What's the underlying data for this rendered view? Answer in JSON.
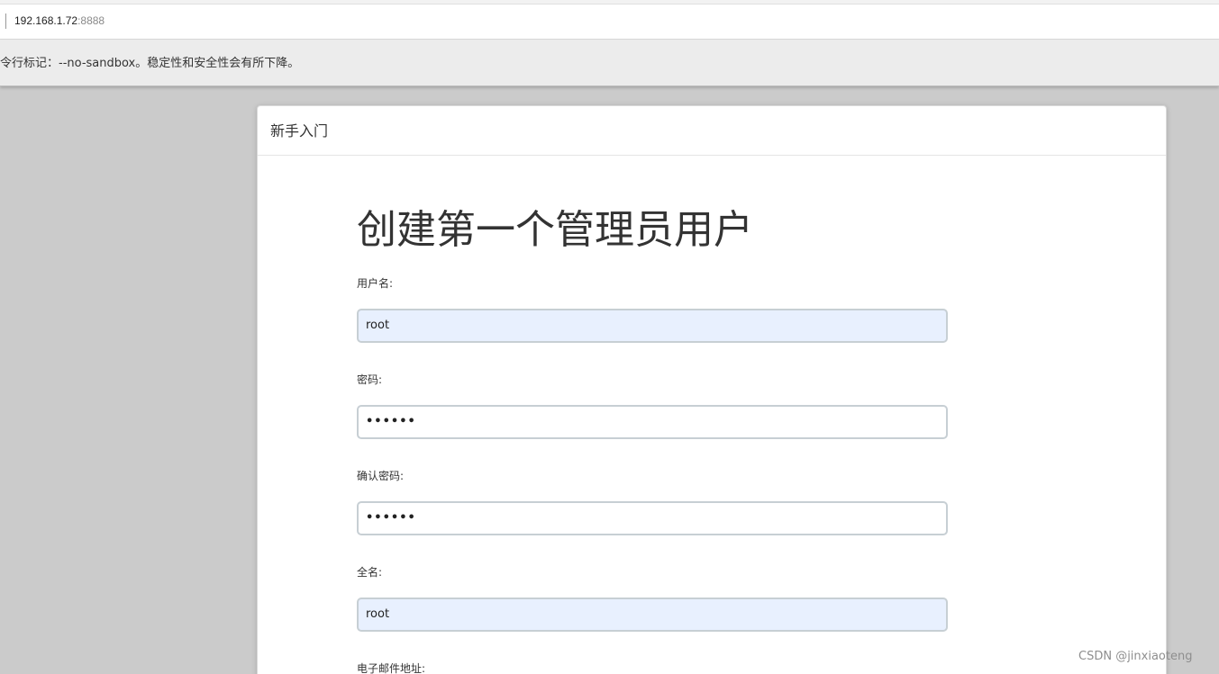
{
  "browser": {
    "url_host": "192.168.1.72",
    "url_port": ":8888",
    "warning_text": "令行标记：--no-sandbox。稳定性和安全性会有所下降。"
  },
  "dialog": {
    "header_title": "新手入门",
    "page_title": "创建第一个管理员用户",
    "fields": [
      {
        "label": "用户名:",
        "value": "root"
      },
      {
        "label": "密码:",
        "value": "••••••"
      },
      {
        "label": "确认密码:",
        "value": "••••••"
      },
      {
        "label": "全名:",
        "value": "root"
      }
    ],
    "next_label": "电子邮件地址:"
  },
  "watermark": "CSDN @jinxiaoteng",
  "colors": {
    "autofill_bg": "#e8f0fe",
    "backdrop": "#cbcbcb"
  }
}
